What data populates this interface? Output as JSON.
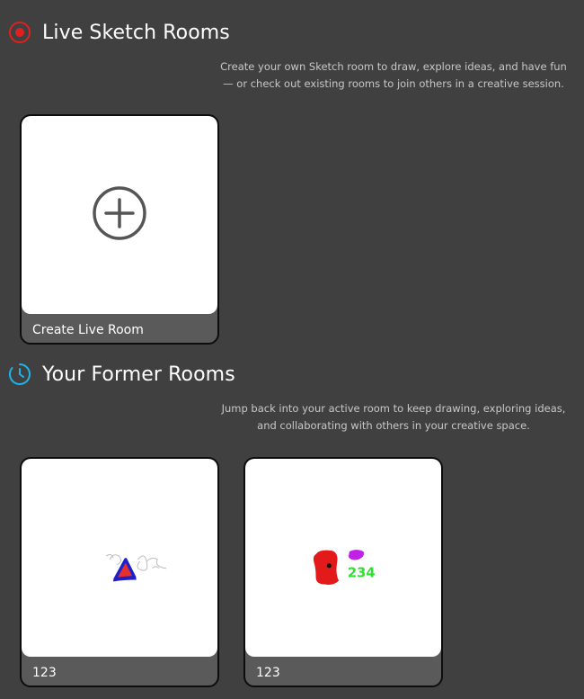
{
  "live": {
    "title": "Live Sketch Rooms",
    "icon": "record-icon",
    "icon_color": "#e0201f",
    "description": "Create your own Sketch room to draw, explore ideas, and have fun — or check out existing rooms to join others in a creative session.",
    "create_card": {
      "label": "Create Live Room",
      "icon": "plus-circle-icon"
    }
  },
  "former": {
    "title": "Your Former Rooms",
    "icon": "clock-icon",
    "icon_color": "#1fb4e6",
    "description": "Jump back into your active room to keep drawing, exploring ideas, and collaborating with others in your creative space.",
    "rooms": [
      {
        "name": "123",
        "thumbnail": "sketch-triangle-doodle"
      },
      {
        "name": "123",
        "thumbnail": "sketch-red-blob-234"
      }
    ]
  }
}
